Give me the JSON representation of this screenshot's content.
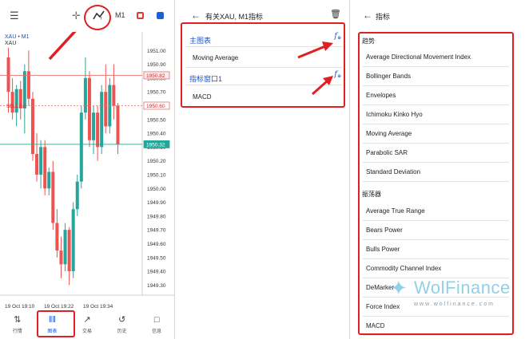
{
  "chart_screen": {
    "toolbar": {
      "menu_icon": "hamburger-icon",
      "crosshair_icon": "crosshair-icon",
      "indicator_icon": "indicator-icon",
      "timeframe": "M1",
      "flag_left_color": "#e53935",
      "flag_right_color": "#1e5fd6"
    },
    "symbol": "XAU • M1",
    "symbol_sub": "XAU",
    "sell_label": "SELL 0.0",
    "price_labels": [
      "1951.00",
      "1950.80",
      "1950.60",
      "1950.40",
      "1950.20",
      "1950.00",
      "1949.90",
      "1949.70",
      "1949.50",
      "1949.30"
    ],
    "price_labels_full": [
      "1951.00",
      "1950.90",
      "1950.80",
      "1950.70",
      "1950.60",
      "1950.50",
      "1950.40",
      "1950.30",
      "1950.20",
      "1950.10",
      "1950.00",
      "1949.90",
      "1949.80",
      "1949.70",
      "1949.60",
      "1949.50",
      "1949.40",
      "1949.30"
    ],
    "tag_ask": "1950.82",
    "tag_sell": "1950.60",
    "tag_bid": "1950.32",
    "time_labels": [
      "19 Oct 19:10",
      "19 Oct 19:22",
      "19 Oct 19:34"
    ],
    "tabs": [
      {
        "label": "行情",
        "icon": "arrows-updown-icon"
      },
      {
        "label": "图表",
        "icon": "candles-icon"
      },
      {
        "label": "交易",
        "icon": "trend-icon"
      },
      {
        "label": "历史",
        "icon": "history-icon"
      },
      {
        "label": "信息",
        "icon": "message-icon"
      }
    ],
    "colors": {
      "bull": "#26a69a",
      "bear": "#ef5350",
      "accent": "#1a56d6",
      "annotation": "#e02020"
    }
  },
  "chart_data": {
    "type": "candlestick",
    "ylim": [
      1949.25,
      1951.1
    ],
    "candles": [
      {
        "o": 1950.95,
        "h": 1951.02,
        "l": 1950.55,
        "c": 1950.7
      },
      {
        "o": 1950.7,
        "h": 1950.8,
        "l": 1950.5,
        "c": 1950.55
      },
      {
        "o": 1950.55,
        "h": 1950.75,
        "l": 1950.45,
        "c": 1950.72
      },
      {
        "o": 1950.72,
        "h": 1950.78,
        "l": 1950.5,
        "c": 1950.58
      },
      {
        "o": 1950.58,
        "h": 1950.9,
        "l": 1950.4,
        "c": 1950.85
      },
      {
        "o": 1950.85,
        "h": 1951.0,
        "l": 1950.6,
        "c": 1950.65
      },
      {
        "o": 1950.65,
        "h": 1950.7,
        "l": 1950.2,
        "c": 1950.25
      },
      {
        "o": 1950.25,
        "h": 1950.4,
        "l": 1950.05,
        "c": 1950.1
      },
      {
        "o": 1950.1,
        "h": 1950.35,
        "l": 1950.0,
        "c": 1950.3
      },
      {
        "o": 1950.3,
        "h": 1950.35,
        "l": 1949.95,
        "c": 1950.0
      },
      {
        "o": 1950.0,
        "h": 1950.15,
        "l": 1949.95,
        "c": 1950.12
      },
      {
        "o": 1950.12,
        "h": 1950.2,
        "l": 1949.7,
        "c": 1949.75
      },
      {
        "o": 1949.75,
        "h": 1949.85,
        "l": 1949.5,
        "c": 1949.55
      },
      {
        "o": 1949.55,
        "h": 1949.65,
        "l": 1949.35,
        "c": 1949.45
      },
      {
        "o": 1949.45,
        "h": 1949.75,
        "l": 1949.4,
        "c": 1949.7
      },
      {
        "o": 1949.7,
        "h": 1949.72,
        "l": 1949.3,
        "c": 1949.4
      },
      {
        "o": 1949.4,
        "h": 1949.9,
        "l": 1949.35,
        "c": 1949.85
      },
      {
        "o": 1949.85,
        "h": 1950.1,
        "l": 1949.8,
        "c": 1950.05
      },
      {
        "o": 1950.05,
        "h": 1950.6,
        "l": 1950.0,
        "c": 1950.55
      },
      {
        "o": 1950.55,
        "h": 1950.95,
        "l": 1950.5,
        "c": 1950.8
      },
      {
        "o": 1950.8,
        "h": 1950.85,
        "l": 1950.3,
        "c": 1950.35
      },
      {
        "o": 1950.35,
        "h": 1950.6,
        "l": 1950.25,
        "c": 1950.55
      },
      {
        "o": 1950.55,
        "h": 1950.6,
        "l": 1950.2,
        "c": 1950.3
      },
      {
        "o": 1950.3,
        "h": 1950.75,
        "l": 1950.25,
        "c": 1950.7
      },
      {
        "o": 1950.7,
        "h": 1950.9,
        "l": 1950.4,
        "c": 1950.45
      },
      {
        "o": 1950.45,
        "h": 1950.8,
        "l": 1950.4,
        "c": 1950.75
      },
      {
        "o": 1950.75,
        "h": 1950.9,
        "l": 1950.5,
        "c": 1950.6
      },
      {
        "o": 1950.6,
        "h": 1950.62,
        "l": 1950.25,
        "c": 1950.32
      }
    ],
    "ask": 1950.82,
    "sell": 1950.6,
    "bid": 1950.32
  },
  "indicators_screen": {
    "back_icon": "arrow-left-icon",
    "title": "有关XAU, M1指标",
    "trash_icon": "trash-icon",
    "main_chart_label": "主图表",
    "main_chart_items": [
      "Moving Average"
    ],
    "window_label": "指标窗口1",
    "window_items": [
      "MACD"
    ],
    "add_icon": "fx-add-icon"
  },
  "list_screen": {
    "back_icon": "arrow-left-icon",
    "title": "指标",
    "trend_label": "趋势",
    "trend_items": [
      "Average Directional Movement Index",
      "Bollinger Bands",
      "Envelopes",
      "Ichimoku Kinko Hyo",
      "Moving Average",
      "Parabolic SAR",
      "Standard Deviation"
    ],
    "osc_label": "振荡器",
    "osc_items": [
      "Average True Range",
      "Bears Power",
      "Bulls Power",
      "Commodity Channel Index",
      "DeMarker",
      "Force Index",
      "MACD"
    ]
  },
  "watermark": {
    "brand": "WolFinance",
    "url": "www.wolfinance.com",
    "logo_icon": "wolf-logo-icon"
  }
}
